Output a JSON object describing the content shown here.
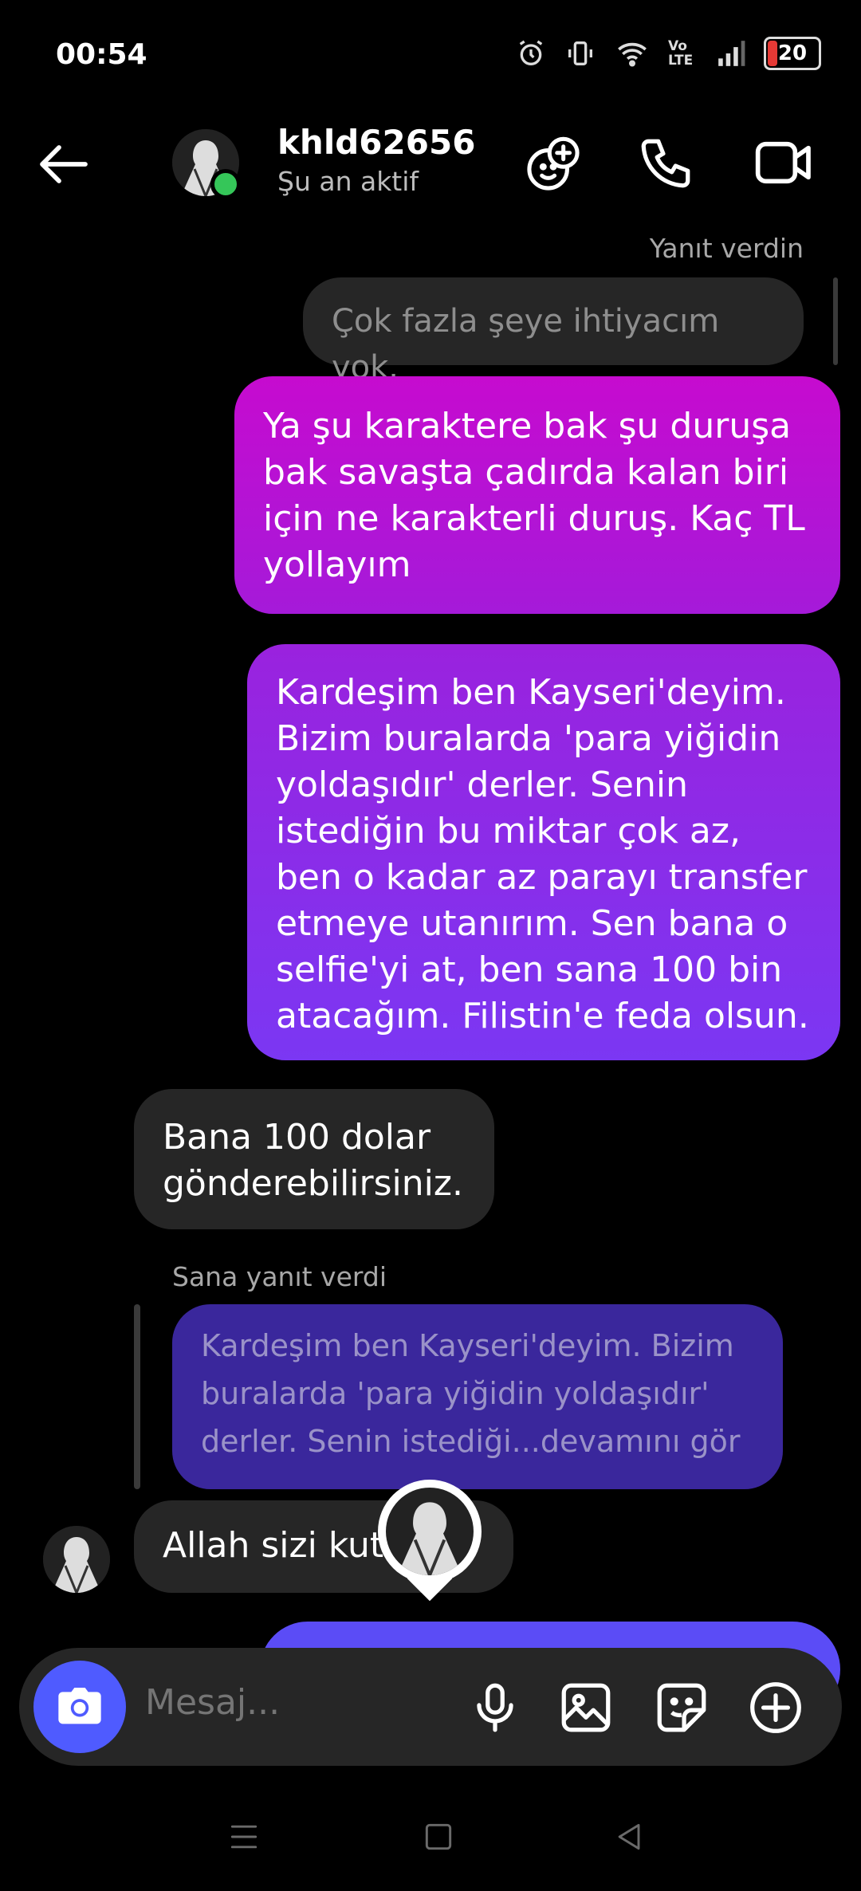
{
  "status_bar": {
    "time": "00:54",
    "battery": "20",
    "network": "Vo LTE"
  },
  "header": {
    "username": "khld62656",
    "status": "Şu an aktif"
  },
  "messages": {
    "reply_label_me": "Yanıt verdin",
    "quoted_by_me": "Çok fazla şeye ihtiyacım yok.",
    "sent_1": "Ya şu karaktere bak şu duruşa bak savaşta çadırda kalan biri için ne karakterli duruş. Kaç TL yollayım",
    "sent_2": "Kardeşim ben Kayseri'deyim. Bizim buralarda 'para yiğidin yoldaşıdır' derler. Senin istediğin bu miktar çok az, ben o kadar az parayı transfer etmeye utanırım. Sen bana o selfie'yi at, ben sana 100 bin atacağım. Filistin'e feda olsun.",
    "received_1": "Bana 100 dolar gönderebilirsiniz.",
    "reply_label_them": "Sana yanıt verdi",
    "quoted_by_them": "Kardeşim ben Kayseri'deyim. Bizim buralarda 'para yiğidin yoldaşıdır' derler. Senin istediği...devamını gör",
    "received_2": "Allah sizi kutlasın."
  },
  "composer": {
    "placeholder": "Mesaj..."
  },
  "colors": {
    "accent": "#4f5bff",
    "bubble_top": "#c30bd0",
    "bubble_bottom": "#6e3cf7",
    "received_bg": "#262626"
  }
}
